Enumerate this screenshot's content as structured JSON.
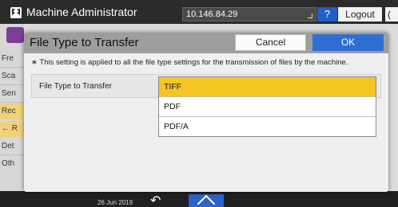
{
  "topbar": {
    "title": "Machine Administrator",
    "ip_address": "10.146.84.29",
    "help_label": "?",
    "logout_label": "Logout",
    "extra_glyph": "("
  },
  "background_menu": {
    "items": [
      "Fre",
      "Sca",
      "Sen",
      "Rec",
      "← R",
      "Det",
      "Oth"
    ]
  },
  "dialog": {
    "title": "File Type to Transfer",
    "cancel_label": "Cancel",
    "ok_label": "OK",
    "note": "∗ This setting is applied to all the file type settings for the transmission of files by the machine.",
    "setting_label": "File Type to Transfer",
    "options": [
      {
        "label": "TIFF",
        "selected": true
      },
      {
        "label": "PDF",
        "selected": false
      },
      {
        "label": "PDF/A",
        "selected": false
      }
    ]
  },
  "bottombar": {
    "date": "26 Jun 2019",
    "back_glyph": "↶"
  },
  "colors": {
    "selection": "#f5c623",
    "ok_button": "#2f6fd3",
    "header": "#9e9e9e"
  }
}
